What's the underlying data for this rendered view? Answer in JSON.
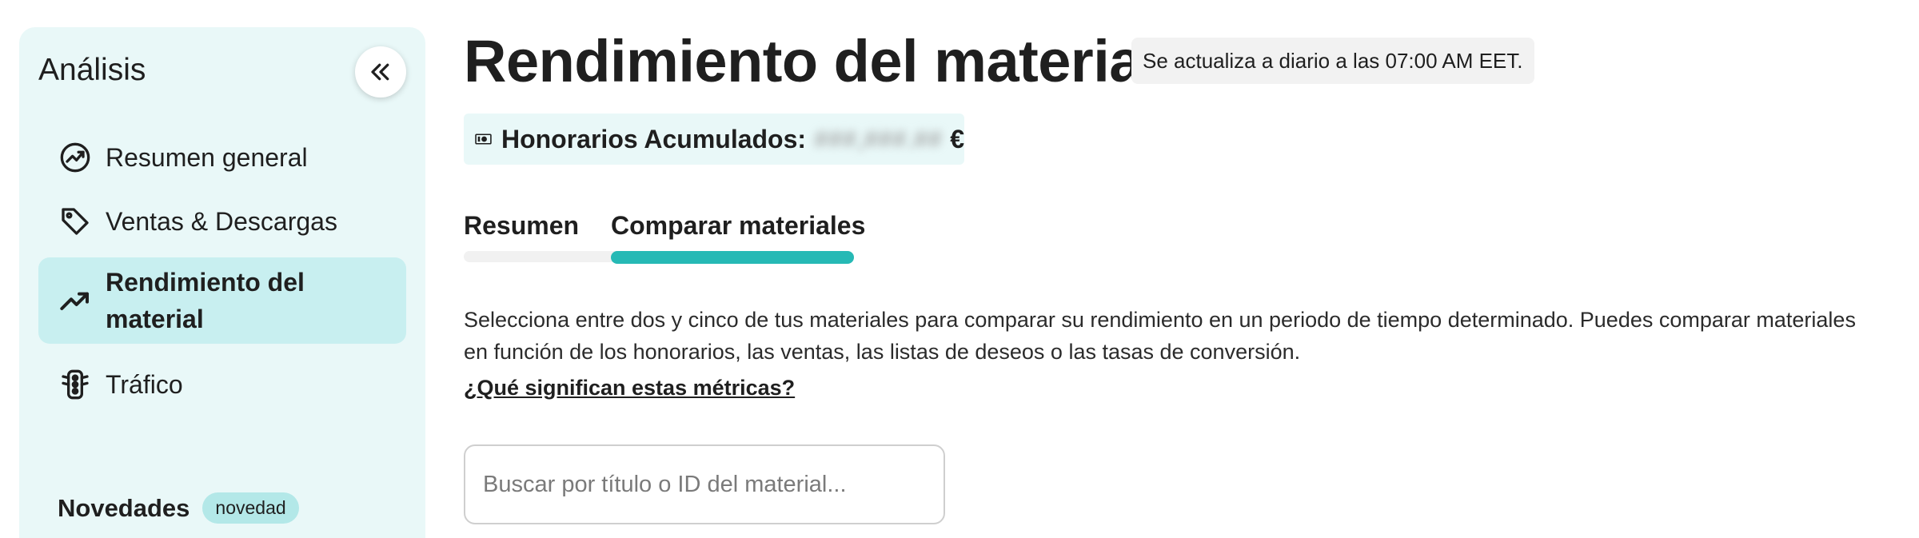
{
  "sidebar": {
    "title": "Análisis",
    "items": [
      {
        "label": "Resumen general",
        "icon": "chart-trend-circle-icon"
      },
      {
        "label": "Ventas & Descargas",
        "icon": "tag-icon"
      },
      {
        "label": "Rendimiento del material",
        "icon": "trending-up-icon",
        "active": true
      },
      {
        "label": "Tráfico",
        "icon": "traffic-light-icon"
      }
    ],
    "news": {
      "title": "Novedades",
      "badge": "novedad"
    }
  },
  "header": {
    "title": "Rendimiento del material",
    "update_note": "Se actualiza a diario a las 07:00 AM EET.",
    "fees": {
      "label": "Honorarios Acumulados:",
      "value": "###,###.##",
      "currency": "€"
    }
  },
  "tabs": [
    {
      "label": "Resumen",
      "active": false
    },
    {
      "label": "Comparar materiales",
      "active": true
    }
  ],
  "main": {
    "description": "Selecciona entre dos y cinco de tus materiales para comparar su rendimiento en un periodo de tiempo determinado. Puedes comparar materiales en función de los honorarios, las ventas, las listas de deseos o las tasas de conversión.",
    "metrics_link": "¿Qué significan estas métricas?",
    "search": {
      "placeholder": "Buscar por título o ID del material...",
      "value": ""
    }
  },
  "colors": {
    "accent": "#26b9b5",
    "sidebar_bg": "#e9f8f8",
    "active_bg": "#c8eff0"
  }
}
